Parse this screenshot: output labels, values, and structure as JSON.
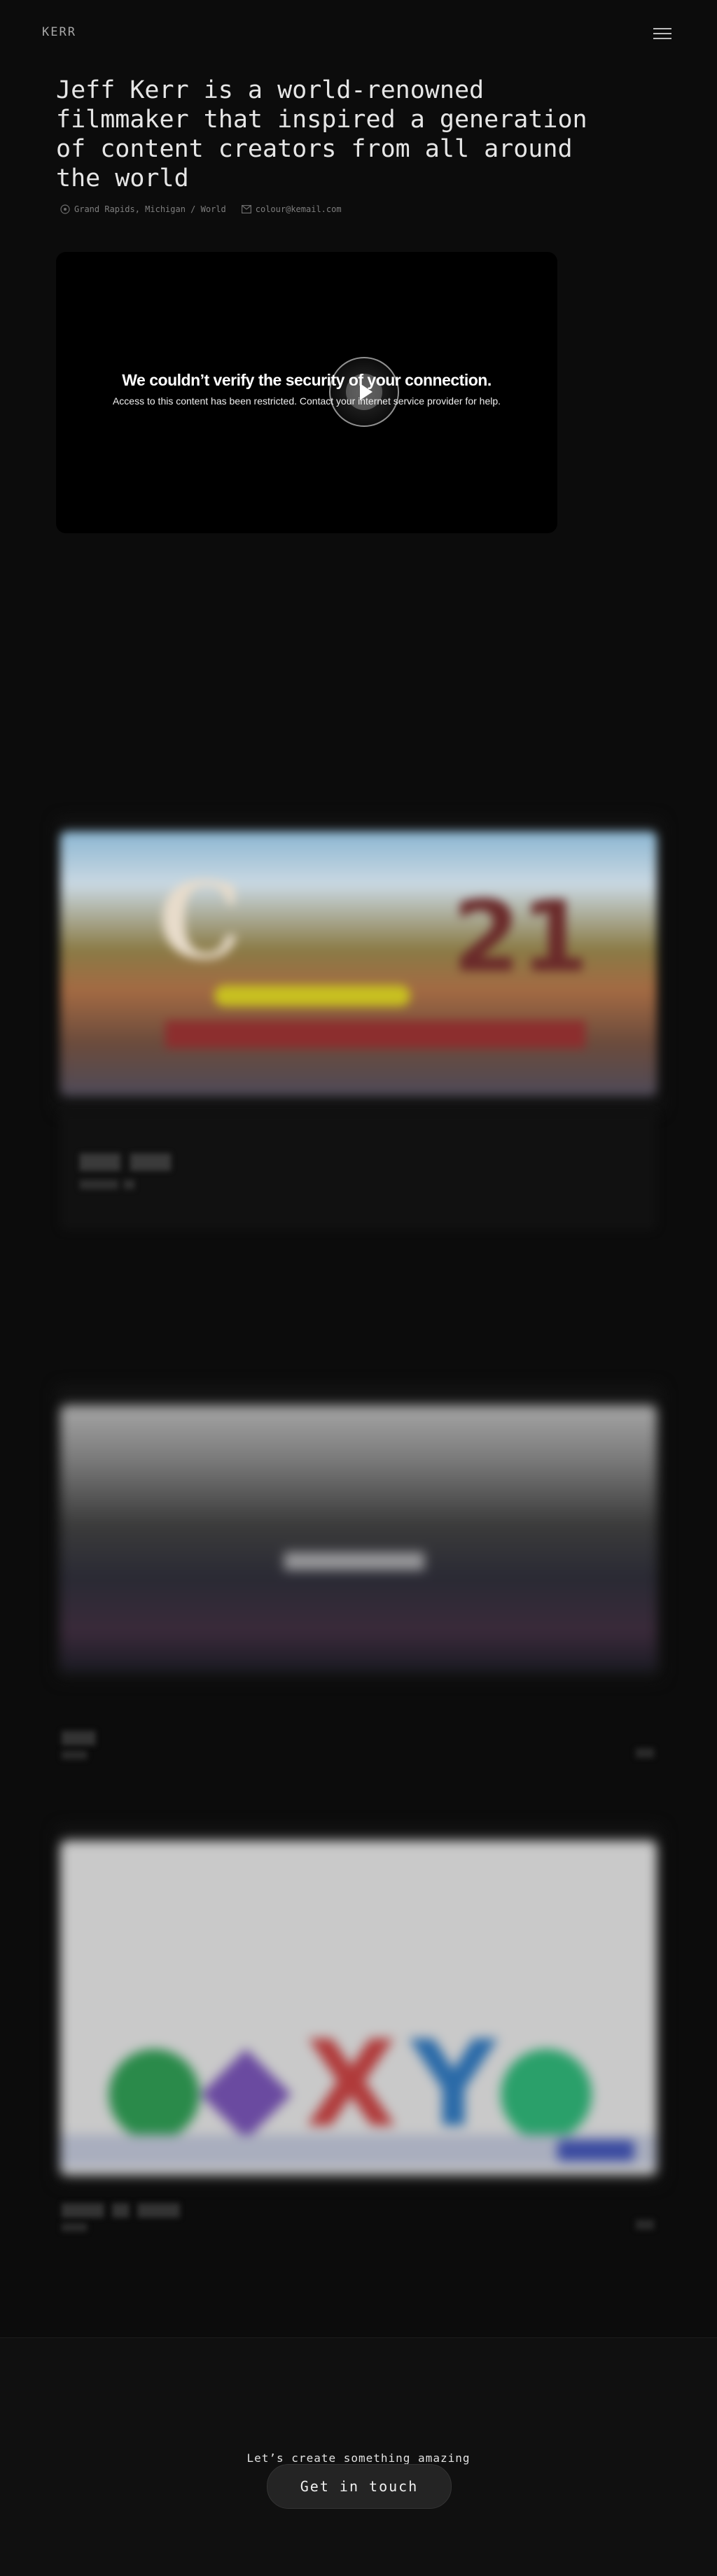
{
  "header": {
    "logo": "KERR",
    "menu_icon": "hamburger-menu-icon"
  },
  "hero": {
    "title": "Jeff Kerr is a world-renowned filmmaker that inspired a generation of content creators from all around the world",
    "location": "Grand Rapids, Michigan / World",
    "email": "colour@kemail.com",
    "location_icon": "map-pin-icon",
    "email_icon": "envelope-icon"
  },
  "video": {
    "error_title": "We couldn’t verify the security of your connection.",
    "error_body": "Access to this content has been restricted. Contact your internet service provider for help.",
    "play_icon": "play-icon"
  },
  "footer": {
    "lead": "Let’s create something amazing",
    "cta_label": "Get in touch"
  },
  "colors": {
    "background": "#0c0c0c",
    "text": "#e6e6e6",
    "muted": "#7e7e7e",
    "cta_bg": "#242424"
  }
}
